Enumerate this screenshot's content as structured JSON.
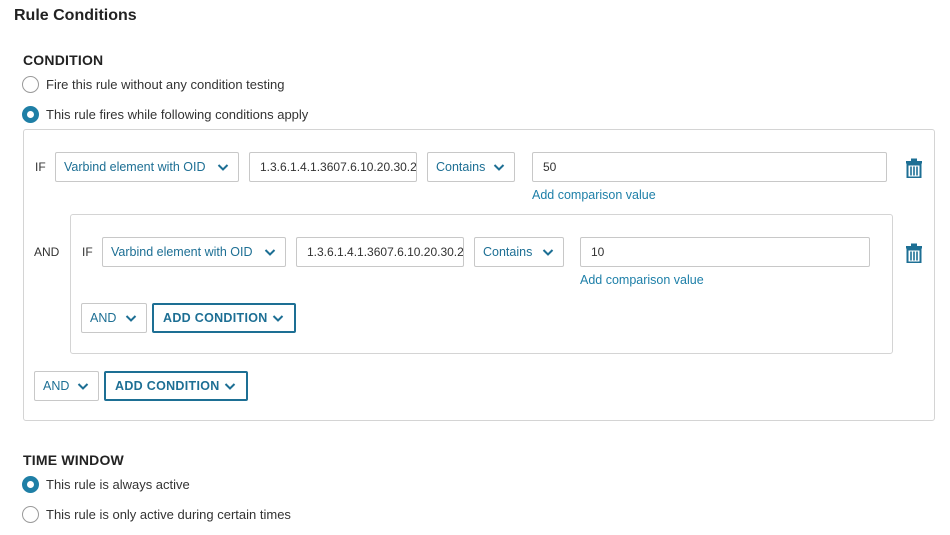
{
  "title": "Rule Conditions",
  "condition": {
    "heading": "CONDITION",
    "options": [
      {
        "label": "Fire this rule without any condition testing",
        "checked": false
      },
      {
        "label": "This rule fires while following conditions apply",
        "checked": true
      }
    ],
    "rule1": {
      "keyword": "IF",
      "element": "Varbind element with OID",
      "oid": "1.3.6.1.4.1.3607.6.10.20.30.2",
      "operator": "Contains",
      "value": "50",
      "add_value_link": "Add comparison value",
      "delete_icon": "trash-icon"
    },
    "group": {
      "connector": "AND",
      "rule": {
        "keyword": "IF",
        "element": "Varbind element with OID",
        "oid": "1.3.6.1.4.1.3607.6.10.20.30.2",
        "operator": "Contains",
        "value": "10",
        "add_value_link": "Add comparison value"
      },
      "logic": "AND",
      "add_condition": "ADD CONDITION",
      "delete_icon": "trash-icon"
    },
    "logic": "AND",
    "add_condition": "ADD CONDITION"
  },
  "time_window": {
    "heading": "TIME WINDOW",
    "options": [
      {
        "label": "This rule is always active",
        "checked": true
      },
      {
        "label": "This rule is only active during certain times",
        "checked": false
      }
    ]
  },
  "colors": {
    "accent": "#1d6f94",
    "link": "#1d7fa8",
    "border": "#d4d4d4"
  }
}
